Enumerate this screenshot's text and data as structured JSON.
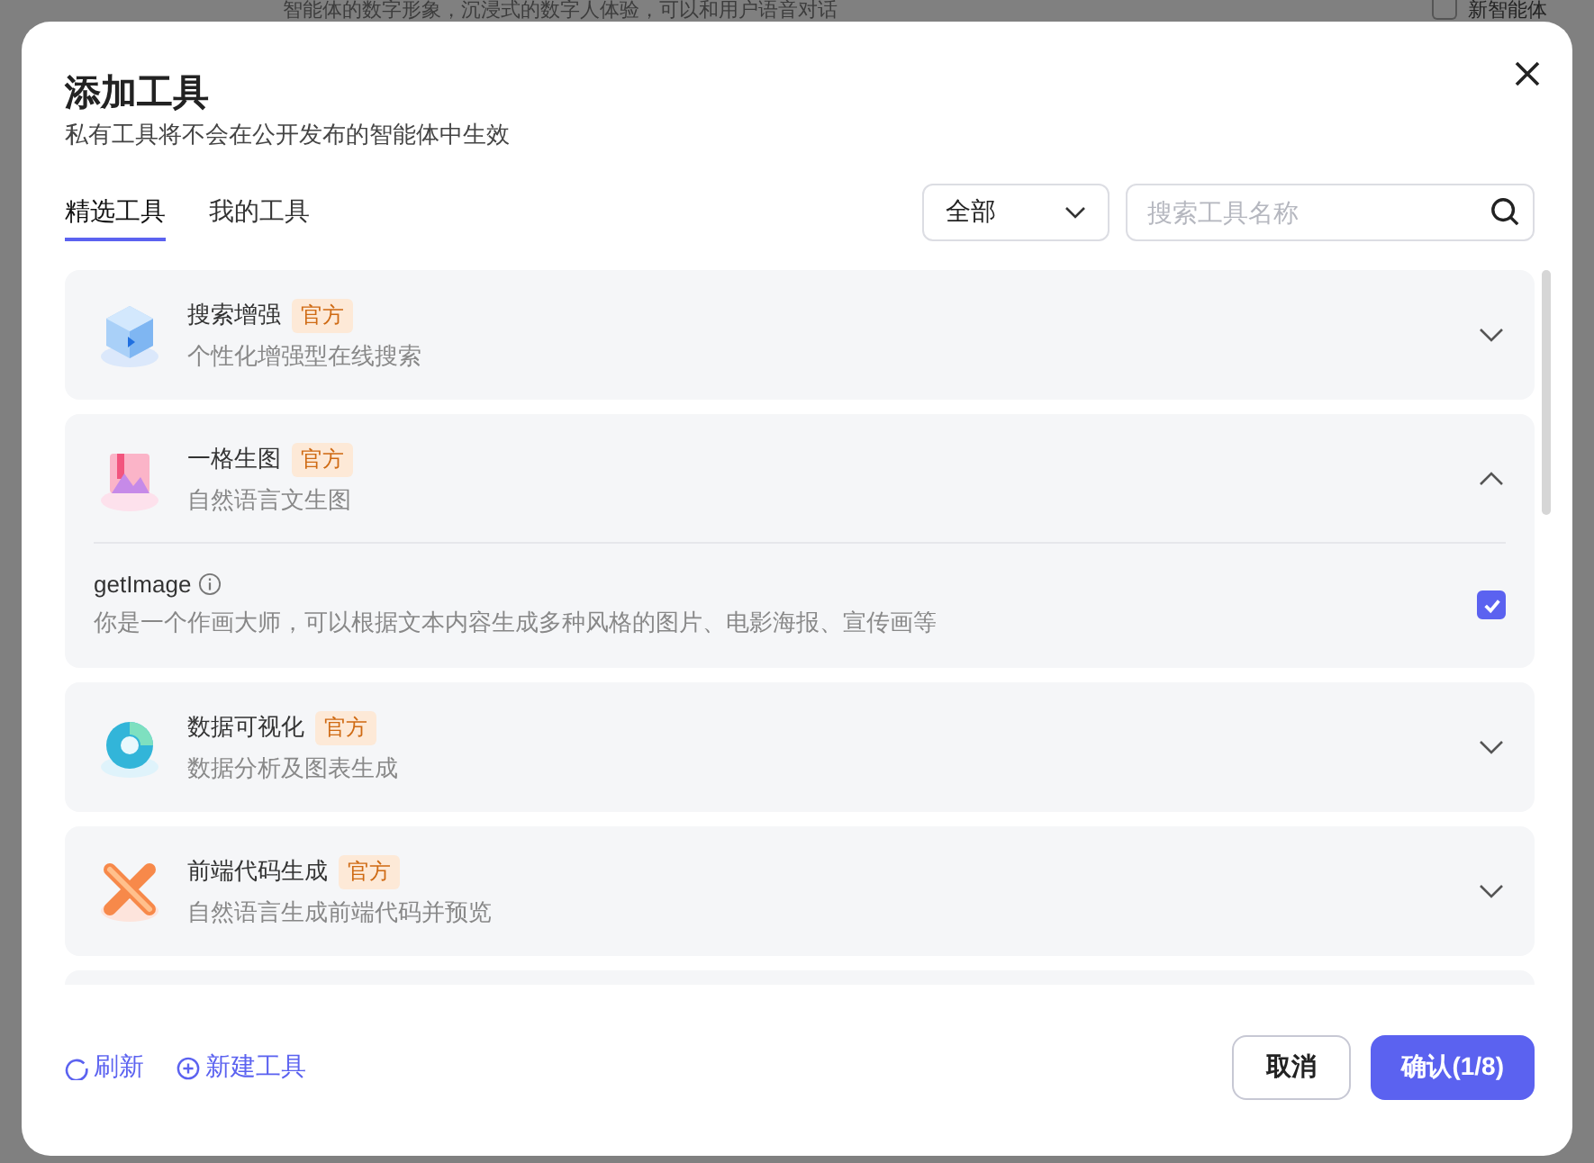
{
  "background": {
    "description": "智能体的数字形象，沉浸式的数字人体验，可以和用户语音对话",
    "side_title": "新智能体"
  },
  "dialog": {
    "title": "添加工具",
    "subtitle": "私有工具将不会在公开发布的智能体中生效"
  },
  "tabs": [
    {
      "label": "精选工具",
      "selected": true
    },
    {
      "label": "我的工具",
      "selected": false
    }
  ],
  "filter": {
    "value": "全部"
  },
  "search": {
    "placeholder": "搜索工具名称"
  },
  "tools": [
    {
      "kind": "cube",
      "name": "搜索增强",
      "badge": "官方",
      "description": "个性化增强型在线搜索",
      "expanded": false
    },
    {
      "kind": "image",
      "name": "一格生图",
      "badge": "官方",
      "description": "自然语言文生图",
      "expanded": true,
      "functions": [
        {
          "name": "getImage",
          "description": "你是一个作画大师，可以根据文本内容生成多种风格的图片、电影海报、宣传画等",
          "checked": true
        }
      ]
    },
    {
      "kind": "chart",
      "name": "数据可视化",
      "badge": "官方",
      "description": "数据分析及图表生成",
      "expanded": false
    },
    {
      "kind": "code",
      "name": "前端代码生成",
      "badge": "官方",
      "description": "自然语言生成前端代码并预览",
      "expanded": false
    }
  ],
  "footer": {
    "links": [
      {
        "kind": "refresh",
        "label": "刷新"
      },
      {
        "kind": "add",
        "label": "新建工具"
      }
    ],
    "buttons": [
      {
        "kind": "secondary",
        "label": "取消"
      },
      {
        "kind": "primary",
        "label": "确认(1/8)"
      }
    ]
  }
}
